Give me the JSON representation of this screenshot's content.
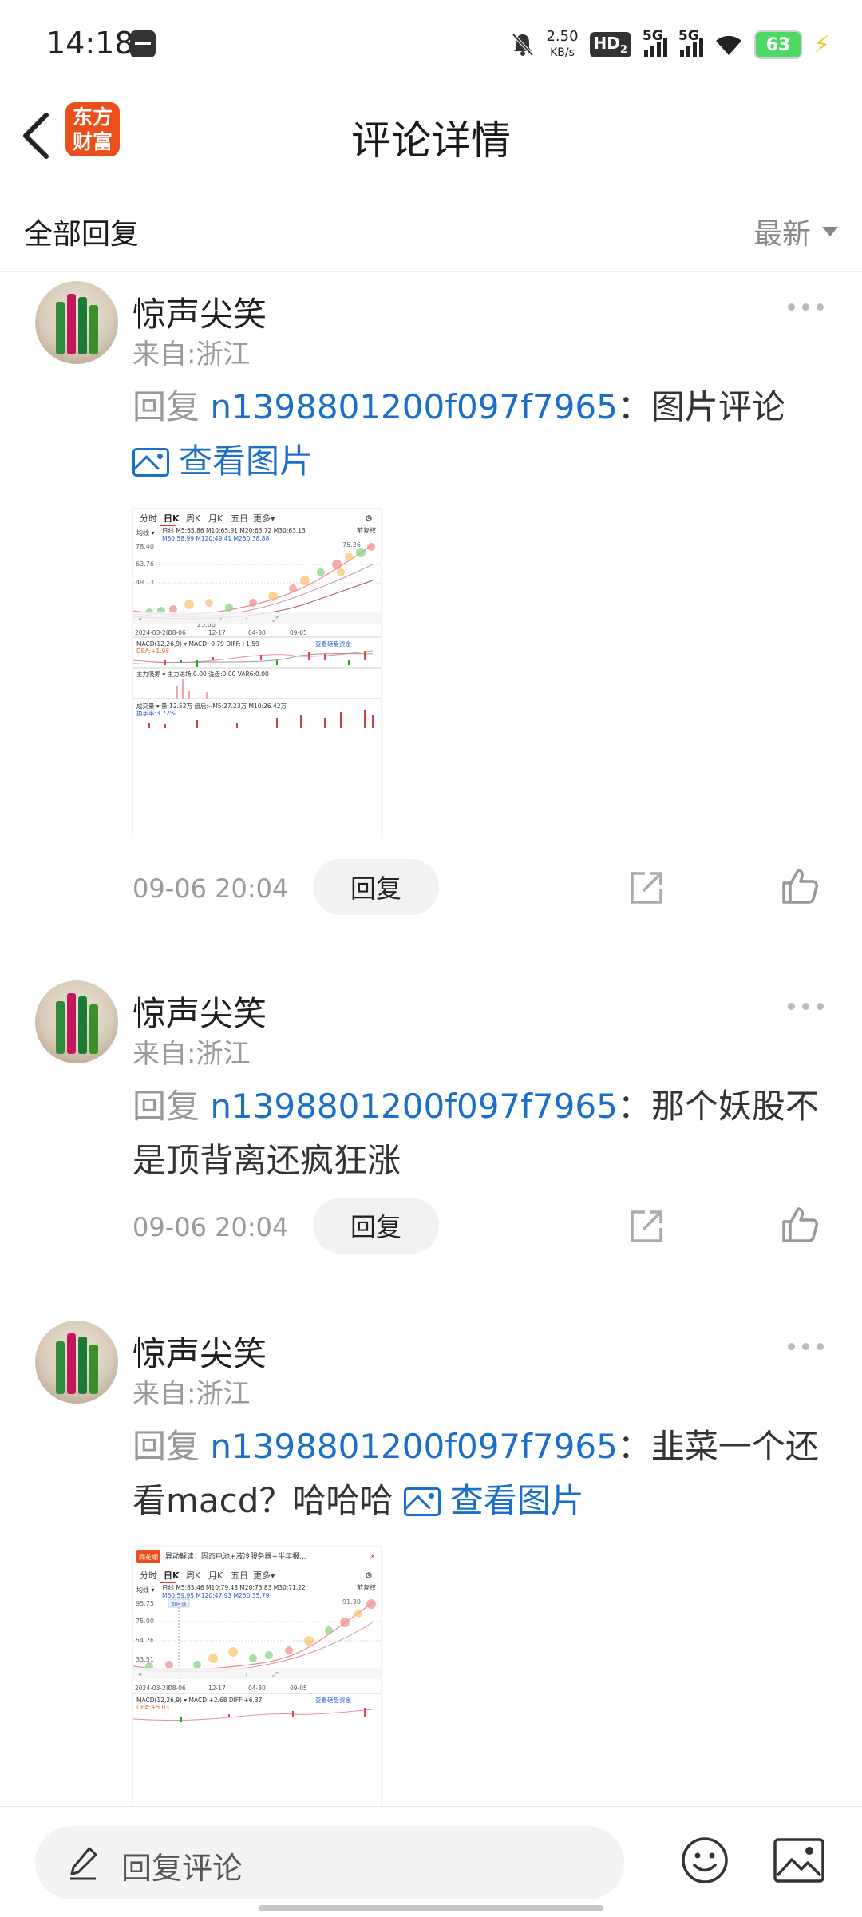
{
  "status_bar": {
    "time": "14:18",
    "net_speed_value": "2.50",
    "net_speed_unit": "KB/s",
    "hd_label": "HD",
    "hd_sub": "2",
    "signal1_label": "5G",
    "signal2_label": "5G",
    "battery_level": "63"
  },
  "header": {
    "logo_text": "东方财富",
    "title": "评论详情"
  },
  "filter": {
    "title": "全部回复",
    "sort_label": "最新"
  },
  "comments": [
    {
      "username": "惊声尖笑",
      "from": "来自:浙江",
      "reply_prefix": "回复 ",
      "reply_to": "n1398801200f097f7965",
      "separator": "：",
      "text": "图片评论",
      "view_image": "查看图片",
      "time": "09-06 20:04",
      "reply_button": "回复"
    },
    {
      "username": "惊声尖笑",
      "from": "来自:浙江",
      "reply_prefix": "回复 ",
      "reply_to": "n1398801200f097f7965",
      "separator": "：",
      "text": "那个妖股不是顶背离还疯狂涨",
      "time": "09-06 20:04",
      "reply_button": "回复"
    },
    {
      "username": "惊声尖笑",
      "from": "来自:浙江",
      "reply_prefix": "回复 ",
      "reply_to": "n1398801200f097f7965",
      "separator": "：",
      "text": "韭菜一个还看macd？哈哈哈",
      "view_image": "查看图片",
      "reply_button": "回复"
    }
  ],
  "thumb1": {
    "tabs": [
      "分时",
      "日K",
      "周K",
      "月K",
      "五日",
      "更多▾"
    ],
    "ma_line1": "日线  M5:65.86  M10:65.91  M20:63.72  M30:63.13",
    "ma_line2": "M60:58.99  M120:49.41  M250:38.88",
    "left_label": "均线 ▾",
    "right_label": "前复权",
    "y_labels": [
      "78.40",
      "63.76",
      "49.13",
      "23.00"
    ],
    "peak_label": "75.26",
    "x_labels": [
      "2024-03-28",
      "08-06",
      "12-17",
      "04-30",
      "09-05"
    ],
    "macd_label": "MACD(12,26,9) ▾  MACD:-0.79  DIFF:+1.59",
    "macd_link": "查看砸盘资金",
    "dea_label": "DEA:+1.98",
    "fund_label": "主力吸筹 ▾  主力进场:0.00  洗盘:0.00  VAR6:0.00",
    "vol_label": "成交量 ▾  量:12.52万  盘后:--M5:27.23万  M10:26.42万",
    "turnover_label": "换手率:3.72%"
  },
  "thumb3": {
    "news_badge": "同花顺",
    "news_title": "异动解读：固态电池+液冷服务器+半年报...",
    "tabs": [
      "分时",
      "日K",
      "周K",
      "月K",
      "五日",
      "更多▾"
    ],
    "ma_line1": "日线  M5:85.46  M10:79.43  M20:73.83  M30:71.22",
    "ma_line2": "M60:59.95  M120:47.93  M250:35.79",
    "left_label": "均线 ▾",
    "right_label": "前复权",
    "y_labels": [
      "95.75",
      "75.00",
      "54.26",
      "33.51"
    ],
    "peak_label": "91.30",
    "tag_label": "加自选",
    "x_labels": [
      "2024-03-28",
      "08-06",
      "12-17",
      "04-30",
      "09-05"
    ],
    "macd_label": "MACD(12,26,9) ▾  MACD:+2.68  DIFF:+6.37",
    "macd_link": "查看砸盘资金",
    "dea_label": "DEA:+5.03"
  },
  "bottom_bar": {
    "input_placeholder": "回复评论"
  }
}
